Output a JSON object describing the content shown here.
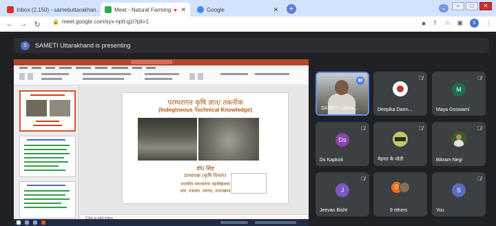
{
  "browser": {
    "tabs": [
      {
        "label": "Inbox (2,150) - sametiuttarakhan...",
        "icon_color": "#d93025"
      },
      {
        "label": "Meet - Natural Farming",
        "icon_color": "#34a853"
      },
      {
        "label": "Google",
        "icon_color": "#4285f4"
      }
    ],
    "new_tab_label": "+",
    "url": "meet.google.com/syx-nptt-gzi?pli=1",
    "profile_initial": "S"
  },
  "meet": {
    "presenting_banner": "SAMETI Uttarakhand is presenting",
    "presenter_initial": "S"
  },
  "slide": {
    "title_hindi": "परम्परागत कृषि ज्ञान/ तकनीक",
    "title_english": "(Indegineous Technical Knowledge)",
    "presenter_name": "डॉ0 सिंह",
    "designation": "प्राध्यापक (कृषि विभाग)",
    "institute_line1": "राजकीय स्नातकोत्तर महाविद्यालय",
    "institute_line2": "ग्राम, पत्रालय, जनपद, उत्तराखण्ड",
    "notes_placeholder": "Click to add notes"
  },
  "participants": [
    {
      "name": "SAMETI Uttara...",
      "type": "video",
      "muted": false
    },
    {
      "name": "Deepika Darm...",
      "type": "photo",
      "muted": true,
      "color": "#ffffff"
    },
    {
      "name": "Maya Goswami",
      "type": "initial",
      "initial": "M",
      "color": "#1e6b52",
      "muted": true
    },
    {
      "name": "Ds Kapkoti",
      "type": "initial",
      "initial": "Ds",
      "color": "#8e44ad",
      "muted": true
    },
    {
      "name": "मेहनत के मोती",
      "type": "photo",
      "muted": true,
      "color": "#c4c46a"
    },
    {
      "name": "Bikram Negi",
      "type": "photo",
      "muted": true,
      "color": "#3c5a2a"
    },
    {
      "name": "Jeevan Bisht",
      "type": "initial",
      "initial": "J",
      "color": "#7e57c2",
      "muted": true
    },
    {
      "name": "9 others",
      "type": "group",
      "initial": "D",
      "color": "#e8711a",
      "muted": false
    },
    {
      "name": "You",
      "type": "initial",
      "initial": "S",
      "color": "#5c6bc0",
      "muted": true
    }
  ]
}
